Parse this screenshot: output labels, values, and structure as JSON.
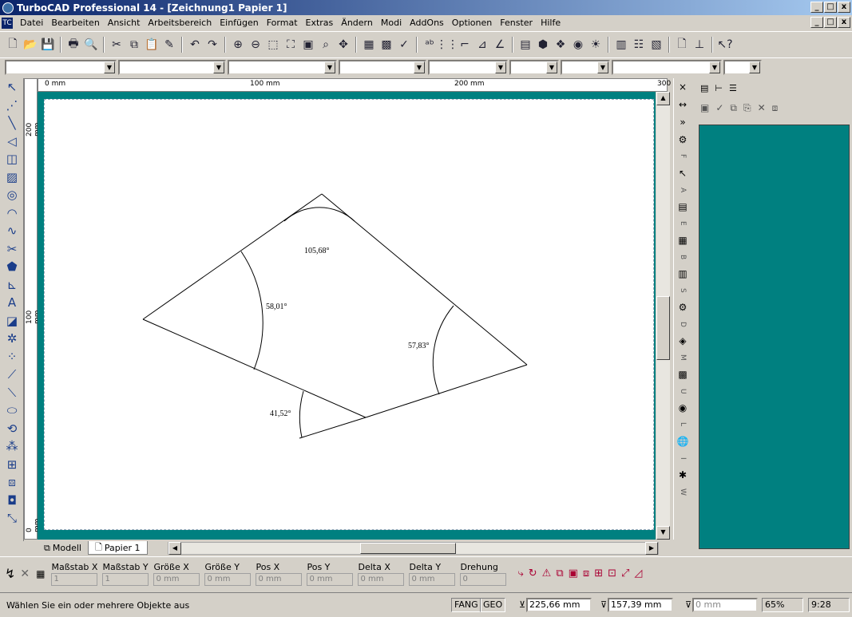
{
  "window": {
    "title": "TurboCAD Professional 14 - [Zeichnung1 Papier 1]",
    "min": "_",
    "max": "□",
    "close": "x"
  },
  "menu": [
    "Datei",
    "Bearbeiten",
    "Ansicht",
    "Arbeitsbereich",
    "Einfügen",
    "Format",
    "Extras",
    "Ändern",
    "Modi",
    "AddOns",
    "Optionen",
    "Fenster",
    "Hilfe"
  ],
  "ruler": {
    "h": [
      "0 mm",
      "100 mm",
      "200 mm",
      "300"
    ],
    "v": [
      "200 mm",
      "100 mm",
      "0 mm"
    ]
  },
  "drawing": {
    "angles": [
      "105,68°",
      "58,01°",
      "57,83°",
      "41,52°"
    ]
  },
  "tabs": {
    "model": "Modell",
    "paper": "Papier 1"
  },
  "right_strip_letters": [
    "F",
    "A",
    "E",
    "B",
    "S",
    "D",
    "M",
    "U",
    "L",
    "I",
    "W"
  ],
  "properties": {
    "labels": [
      "Maßstab X",
      "Maßstab Y",
      "Größe X",
      "Größe Y",
      "Pos X",
      "Pos Y",
      "Delta X",
      "Delta Y",
      "Drehung"
    ],
    "values": [
      "1",
      "1",
      "0 mm",
      "0 mm",
      "0 mm",
      "0 mm",
      "0 mm",
      "0 mm",
      "0"
    ]
  },
  "status": {
    "message": "Wählen Sie ein oder mehrere Objekte aus",
    "fang": "FANG",
    "geo": "GEO",
    "x": "225,66 mm",
    "y": "157,39 mm",
    "z": "0 mm",
    "zoom": "65%",
    "time": "9:28"
  }
}
